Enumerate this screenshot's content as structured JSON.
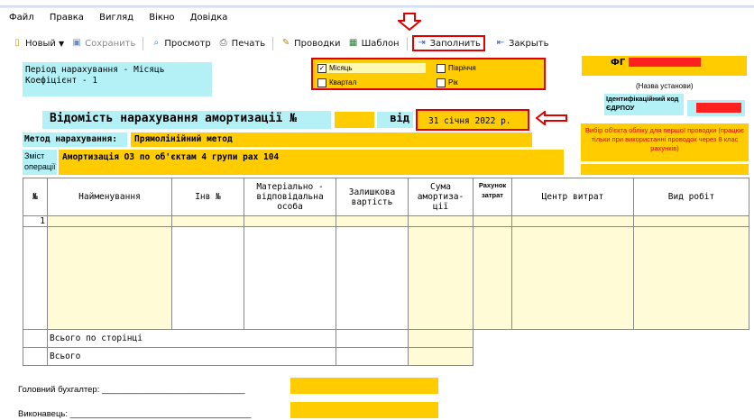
{
  "menu": [
    "Файл",
    "Правка",
    "Вигляд",
    "Вікно",
    "Довідка"
  ],
  "toolbar": {
    "new": "Новый",
    "save": "Сохранить",
    "preview": "Просмотр",
    "print": "Печать",
    "postings": "Проводки",
    "template": "Шаблон",
    "fill": "Заполнить",
    "close": "Закрыть"
  },
  "period": {
    "line1": "Період нарахування - Місяць",
    "line2": "Коефіцієнт - 1"
  },
  "period_options": {
    "month": "Місяць",
    "quarter": "Квартал",
    "semi": "Півріччя",
    "year": "Рік",
    "month_checked": true
  },
  "org": {
    "prefix": "ФГ",
    "name_caption": "(Назва установи)",
    "edrpou_label": "Ідентифікаційний код ЄДРПОУ"
  },
  "doc": {
    "title": "Відомість нарахування амортизації №",
    "from_label": "від",
    "date": "31 січня 2022 р."
  },
  "hint": "Вибір об'єкта обліку для першої проводки (працює тільки при використанні проводок через 8 клас рахунків)",
  "method": {
    "label": "Метод нарахування:",
    "value": "Прямолінійний метод"
  },
  "content": {
    "label": "Зміст операції",
    "value": "Амортизація ОЗ по об'єктам 4 групи рах 104"
  },
  "table": {
    "headers": [
      "№",
      "Найменування",
      "Інв №",
      "Матеріально - відповідальна особа",
      "Залишкова вартість",
      "Сума амортиза- ції",
      "Рахунок затрат",
      "Центр витрат",
      "Вид робіт"
    ],
    "row_no": "1",
    "total_page": "Всього по сторінці",
    "total": "Всього"
  },
  "signatures": {
    "chief": "Головний бухгалтер: ______________________________",
    "executor": "Виконавець: ______________________________________"
  }
}
